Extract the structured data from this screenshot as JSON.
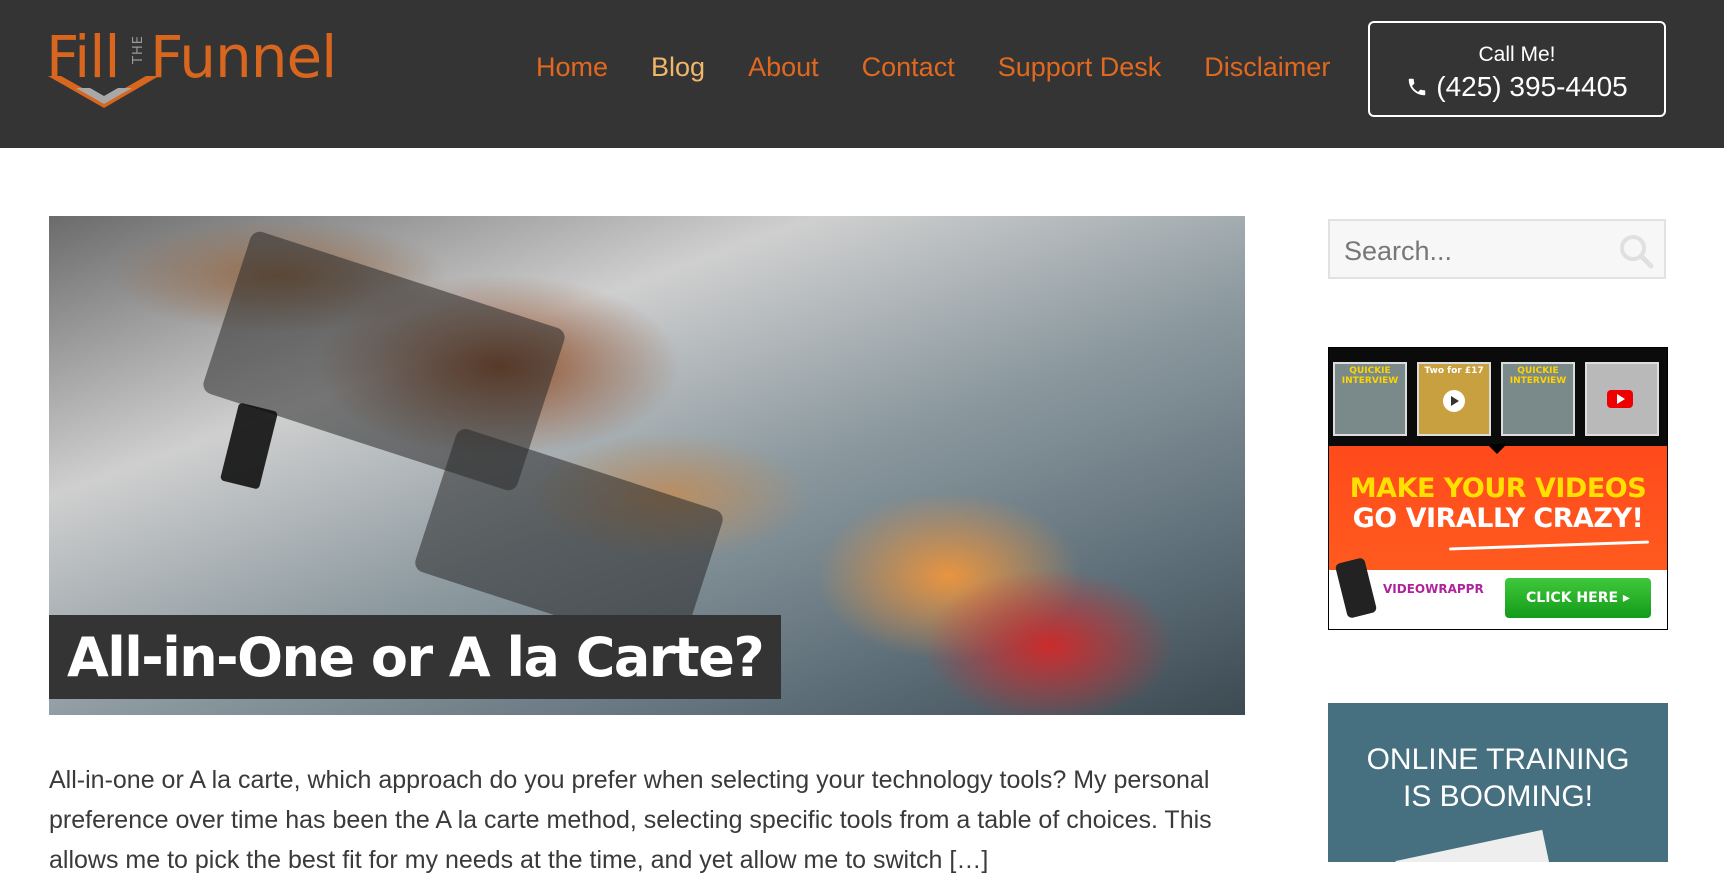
{
  "header": {
    "logo": {
      "fill": "Fill",
      "the": "THE",
      "funnel": "Funnel"
    },
    "nav": [
      {
        "label": "Home",
        "active": false
      },
      {
        "label": "Blog",
        "active": true
      },
      {
        "label": "About",
        "active": false
      },
      {
        "label": "Contact",
        "active": false
      },
      {
        "label": "Support Desk",
        "active": false
      },
      {
        "label": "Disclaimer",
        "active": false
      }
    ],
    "call": {
      "label": "Call Me!",
      "phone": "(425) 395-4405",
      "icon": "phone-icon"
    }
  },
  "post": {
    "title": "All-in-One or A la Carte?",
    "excerpt": "All-in-one or A la carte, which approach do you prefer when selecting your technology tools? My personal preference over time has been the A la carte method, selecting specific tools from a table of choices. This allows me to pick the best fit for my needs at the time, and yet allow me to switch […]"
  },
  "sidebar": {
    "search": {
      "placeholder": "Search...",
      "icon": "search-icon"
    },
    "ad": {
      "thumb_captions": [
        "QUICKIE INTERVIEW",
        "Two for £17",
        "QUICKIE INTERVIEW",
        ""
      ],
      "headline_line1": "MAKE YOUR VIDEOS",
      "headline_line2": "GO VIRALLY CRAZY!",
      "brand": "VIDEOWRAPPR",
      "cta": "CLICK HERE ▸"
    },
    "promo": {
      "line1": "ONLINE TRAINING",
      "line2": "IS BOOMING!"
    }
  },
  "colors": {
    "header_bg": "#343434",
    "nav_link": "#e0691f",
    "nav_active": "#f0b66a",
    "promo_bg": "#46707f"
  }
}
